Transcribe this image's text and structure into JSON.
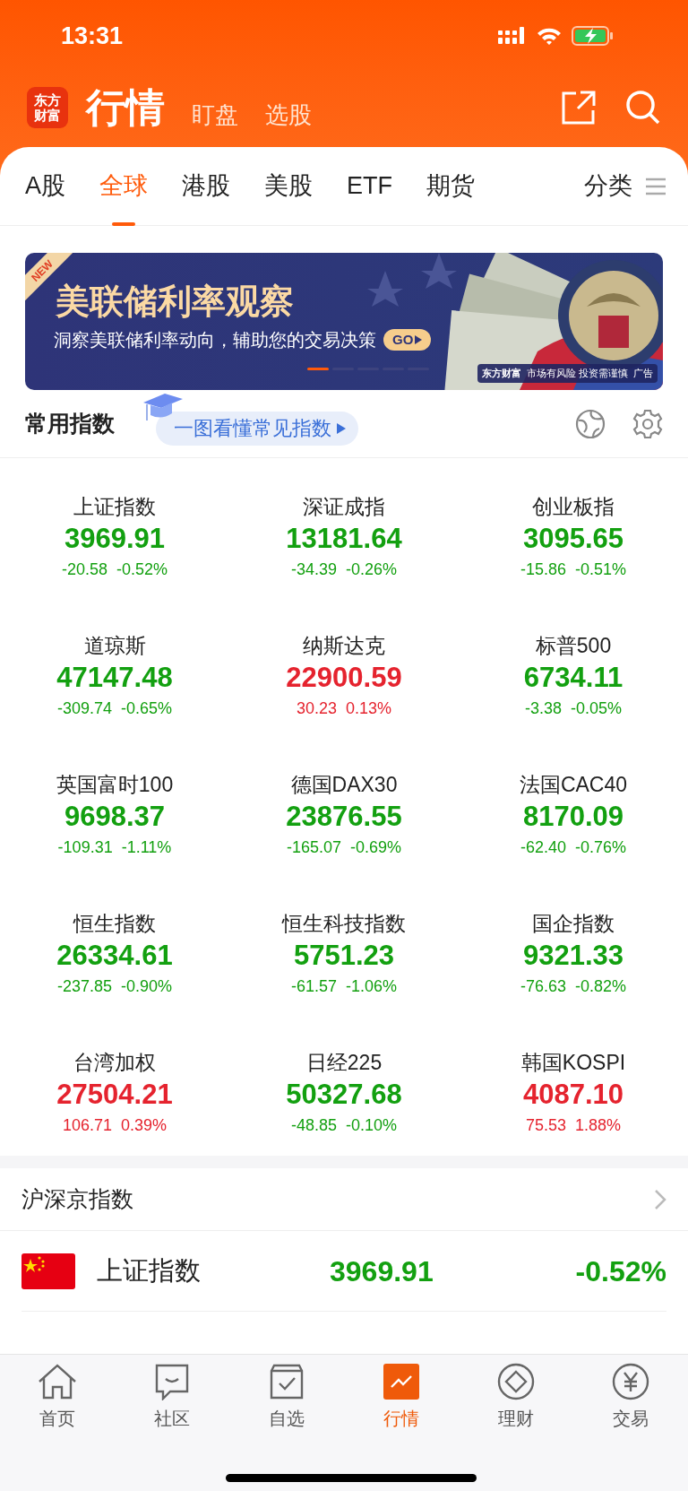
{
  "status_bar": {
    "time": "13:31"
  },
  "header": {
    "logo": "东方财富",
    "title": "行情",
    "links": [
      "盯盘",
      "选股"
    ]
  },
  "tabs": [
    {
      "label": "A股",
      "selected": false
    },
    {
      "label": "全球",
      "selected": true
    },
    {
      "label": "港股",
      "selected": false
    },
    {
      "label": "美股",
      "selected": false
    },
    {
      "label": "ETF",
      "selected": false
    },
    {
      "label": "期货",
      "selected": false
    }
  ],
  "category_button": "分类",
  "banner": {
    "ribbon": "NEW",
    "title": "美联储利率观察",
    "subtitle": "洞察美联储利率动向，辅助您的交易决策",
    "go": "GO",
    "brand": "东方财富",
    "disclaimer": "市场有风险 投资需谨慎",
    "ad": "广告",
    "pages": [
      {
        "selected": true
      },
      {
        "selected": false
      },
      {
        "selected": false
      },
      {
        "selected": false
      },
      {
        "selected": false
      }
    ]
  },
  "section": {
    "title": "常用指数",
    "guide": "一图看懂常见指数"
  },
  "indices": [
    {
      "name": "上证指数",
      "price": "3969.91",
      "change": "-20.58",
      "pct": "-0.52%",
      "rising": false
    },
    {
      "name": "深证成指",
      "price": "13181.64",
      "change": "-34.39",
      "pct": "-0.26%",
      "rising": false
    },
    {
      "name": "创业板指",
      "price": "3095.65",
      "change": "-15.86",
      "pct": "-0.51%",
      "rising": false
    },
    {
      "name": "道琼斯",
      "price": "47147.48",
      "change": "-309.74",
      "pct": "-0.65%",
      "rising": false
    },
    {
      "name": "纳斯达克",
      "price": "22900.59",
      "change": "30.23",
      "pct": "0.13%",
      "rising": true
    },
    {
      "name": "标普500",
      "price": "6734.11",
      "change": "-3.38",
      "pct": "-0.05%",
      "rising": false
    },
    {
      "name": "英国富时100",
      "price": "9698.37",
      "change": "-109.31",
      "pct": "-1.11%",
      "rising": false
    },
    {
      "name": "德国DAX30",
      "price": "23876.55",
      "change": "-165.07",
      "pct": "-0.69%",
      "rising": false
    },
    {
      "name": "法国CAC40",
      "price": "8170.09",
      "change": "-62.40",
      "pct": "-0.76%",
      "rising": false
    },
    {
      "name": "恒生指数",
      "price": "26334.61",
      "change": "-237.85",
      "pct": "-0.90%",
      "rising": false
    },
    {
      "name": "恒生科技指数",
      "price": "5751.23",
      "change": "-61.57",
      "pct": "-1.06%",
      "rising": false
    },
    {
      "name": "国企指数",
      "price": "9321.33",
      "change": "-76.63",
      "pct": "-0.82%",
      "rising": false
    },
    {
      "name": "台湾加权",
      "price": "27504.21",
      "change": "106.71",
      "pct": "0.39%",
      "rising": true
    },
    {
      "name": "日经225",
      "price": "50327.68",
      "change": "-48.85",
      "pct": "-0.10%",
      "rising": false
    },
    {
      "name": "韩国KOSPI",
      "price": "4087.10",
      "change": "75.53",
      "pct": "1.88%",
      "rising": true
    }
  ],
  "list_section": {
    "title": "沪深京指数",
    "rows": [
      {
        "name": "上证指数",
        "price": "3969.91",
        "pct": "-0.52%",
        "rising": false
      }
    ]
  },
  "bottom_nav": [
    {
      "label": "首页",
      "kind": "home",
      "selected": false
    },
    {
      "label": "社区",
      "kind": "chat",
      "selected": false
    },
    {
      "label": "自选",
      "kind": "check",
      "selected": false
    },
    {
      "label": "行情",
      "kind": "chart",
      "selected": true
    },
    {
      "label": "理财",
      "kind": "diamond",
      "selected": false
    },
    {
      "label": "交易",
      "kind": "yen",
      "selected": false
    }
  ]
}
